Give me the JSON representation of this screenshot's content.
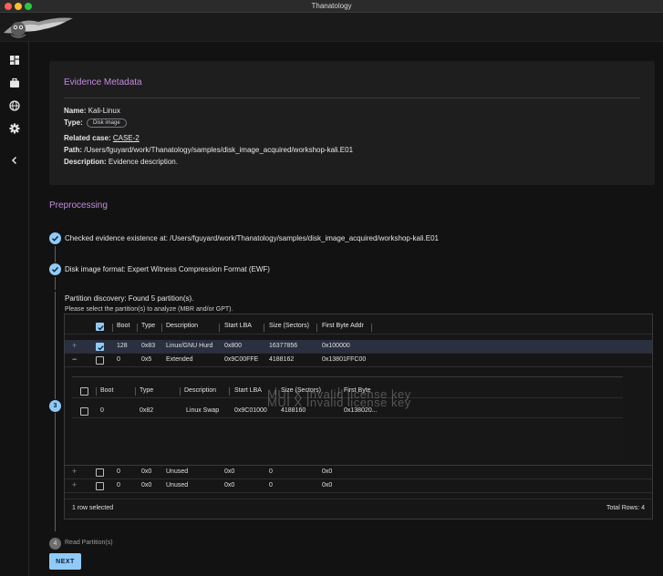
{
  "window": {
    "title": "Thanatology"
  },
  "sidebar": {
    "items": [
      {
        "icon": "dashboard-icon"
      },
      {
        "icon": "briefcase-icon"
      },
      {
        "icon": "globe-icon"
      },
      {
        "icon": "gear-icon"
      },
      {
        "icon": "chevron-left-icon"
      }
    ]
  },
  "metadata": {
    "title": "Evidence Metadata",
    "name_label": "Name:",
    "name_value": "Kali-Linux",
    "type_label": "Type:",
    "type_value": "Disk image",
    "case_label": "Related case:",
    "case_value": "CASE-2",
    "path_label": "Path:",
    "path_value": "/Users/fguyard/work/Thanatology/samples/disk_image_acquired/workshop-kali.E01",
    "desc_label": "Description:",
    "desc_value": "Evidence description."
  },
  "preprocessing": {
    "title": "Preprocessing",
    "step1": "Checked evidence existence at: /Users/fguyard/work/Thanatology/samples/disk_image_acquired/workshop-kali.E01",
    "step2": "Disk image format: Expert Witness Compression Format (EWF)",
    "step3_number": "3",
    "step3_title": "Partition discovery: Found 5 partition(s).",
    "step3_sub": "Please select the partition(s) to analyze (MBR and/or GPT).",
    "step4_number": "4",
    "step4": "Read Partition(s)",
    "next_label": "NEXT"
  },
  "grid": {
    "columns": [
      "Boot",
      "Type",
      "Description",
      "Start LBA",
      "Size (Sectors)",
      "First Byte Addr"
    ],
    "rows": [
      {
        "expander": "+",
        "checked": true,
        "boot": "128",
        "type": "0x83",
        "desc": "Linux/GNU Hurd",
        "lba": "0x800",
        "size": "16377856",
        "first": "0x100000"
      },
      {
        "expander": "−",
        "checked": false,
        "boot": "0",
        "type": "0x5",
        "desc": "Extended",
        "lba": "0x9C00FFE",
        "size": "4188162",
        "first": "0x13801FFC00"
      },
      {
        "expander": "+",
        "checked": false,
        "boot": "0",
        "type": "0x0",
        "desc": "Unused",
        "lba": "0x0",
        "size": "0",
        "first": "0x0"
      },
      {
        "expander": "+",
        "checked": false,
        "boot": "0",
        "type": "0x0",
        "desc": "Unused",
        "lba": "0x0",
        "size": "0",
        "first": "0x0"
      }
    ],
    "sub_columns": [
      "Boot",
      "Type",
      "Description",
      "Start LBA",
      "Size (Sectors)",
      "First Byte"
    ],
    "sub_row": {
      "boot": "0",
      "type": "0x82",
      "desc": "Linux Swap",
      "lba": "0x9C01000",
      "size": "4188160",
      "first": "0x138020..."
    },
    "watermark": "MUI X Invalid license key",
    "selected_text": "1 row selected",
    "total_text": "Total Rows: 4"
  },
  "colors": {
    "accent": "#90caf9",
    "heading": "#c48ade"
  }
}
